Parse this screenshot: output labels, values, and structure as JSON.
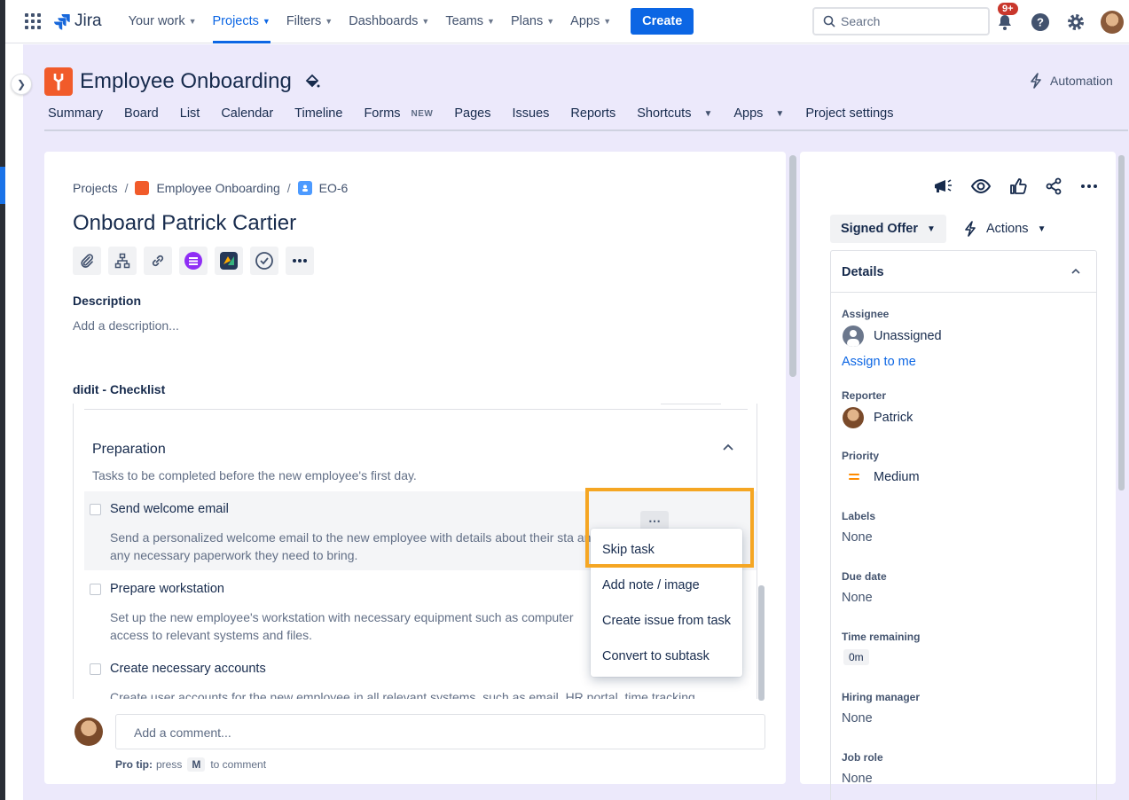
{
  "topnav": {
    "logo_text": "Jira",
    "items": [
      {
        "label": "Your work",
        "active": false
      },
      {
        "label": "Projects",
        "active": true
      },
      {
        "label": "Filters",
        "active": false
      },
      {
        "label": "Dashboards",
        "active": false
      },
      {
        "label": "Teams",
        "active": false
      },
      {
        "label": "Plans",
        "active": false
      },
      {
        "label": "Apps",
        "active": false
      }
    ],
    "create_label": "Create",
    "search_placeholder": "Search",
    "notification_badge": "9+"
  },
  "project": {
    "name": "Employee Onboarding",
    "automation_label": "Automation",
    "tabs": [
      {
        "label": "Summary"
      },
      {
        "label": "Board"
      },
      {
        "label": "List"
      },
      {
        "label": "Calendar"
      },
      {
        "label": "Timeline"
      },
      {
        "label": "Forms",
        "badge": "NEW"
      },
      {
        "label": "Pages"
      },
      {
        "label": "Issues"
      },
      {
        "label": "Reports"
      },
      {
        "label": "Shortcuts",
        "dropdown": true
      },
      {
        "label": "Apps",
        "dropdown": true
      },
      {
        "label": "Project settings"
      }
    ]
  },
  "issue": {
    "breadcrumb": {
      "root": "Projects",
      "project": "Employee Onboarding",
      "key": "EO-6"
    },
    "title": "Onboard Patrick Cartier",
    "description_label": "Description",
    "description_placeholder": "Add a description...",
    "checklist_label": "didit - Checklist",
    "section": {
      "title": "Preparation",
      "description": "Tasks to be completed before the new employee's first day."
    },
    "tasks": [
      {
        "name": "Send welcome email",
        "description": "Send a personalized welcome email to the new employee with details about their sta and any necessary paperwork they need to bring."
      },
      {
        "name": "Prepare workstation",
        "description": "Set up the new employee's workstation with necessary equipment such as computer access to relevant systems and files."
      },
      {
        "name": "Create necessary accounts",
        "description": "Create user accounts for the new employee in all relevant systems, such as email, HR portal, time tracking"
      }
    ],
    "task_menu": [
      "Skip task",
      "Add note / image",
      "Create issue from task",
      "Convert to subtask"
    ],
    "comment_placeholder": "Add a comment...",
    "protip": {
      "label": "Pro tip:",
      "pre": "press",
      "key": "M",
      "post": "to comment"
    }
  },
  "sidebar": {
    "status_label": "Signed Offer",
    "actions_label": "Actions",
    "details_title": "Details",
    "fields": {
      "assignee_label": "Assignee",
      "assignee_value": "Unassigned",
      "assign_to_me": "Assign to me",
      "reporter_label": "Reporter",
      "reporter_value": "Patrick",
      "priority_label": "Priority",
      "priority_value": "Medium",
      "labels_label": "Labels",
      "labels_value": "None",
      "due_label": "Due date",
      "due_value": "None",
      "time_label": "Time remaining",
      "time_value": "0m",
      "hiring_label": "Hiring manager",
      "hiring_value": "None",
      "jobrole_label": "Job role",
      "jobrole_value": "None"
    }
  },
  "colors": {
    "accent": "#0c66e4",
    "project_bg": "#ece9fb",
    "highlight": "#f5a623",
    "project_icon": "#f15b2a"
  }
}
